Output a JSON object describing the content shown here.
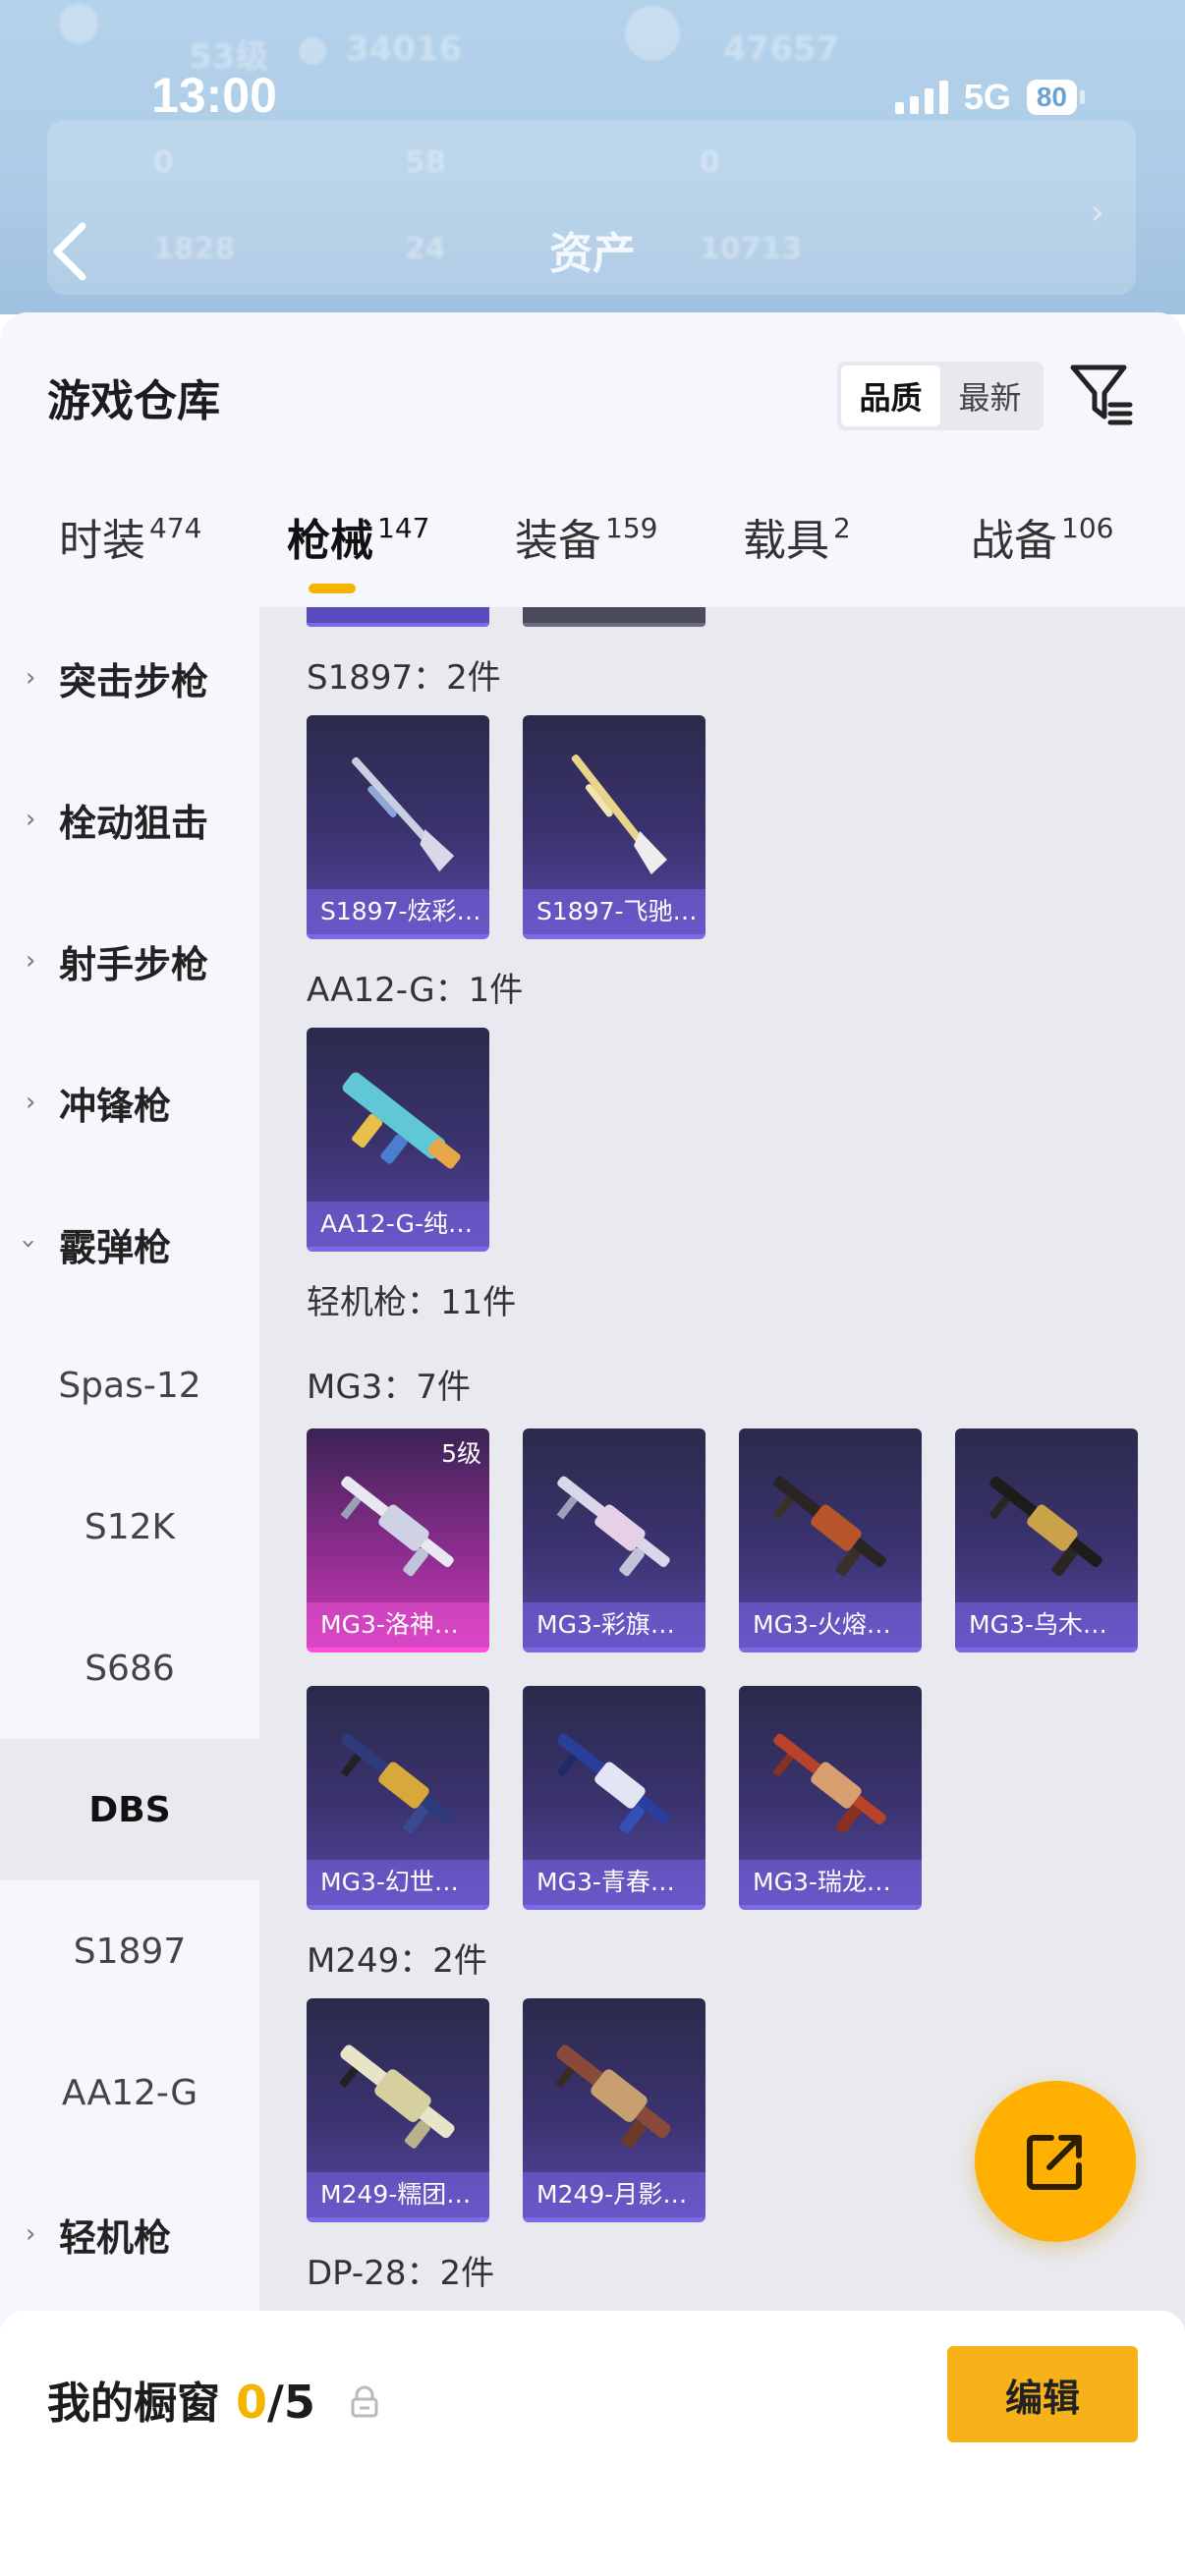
{
  "status_bar": {
    "time": "13:00",
    "network": "5G",
    "battery": "80"
  },
  "header": {
    "title": "资产"
  },
  "header_background_text": [
    "53级",
    "34016",
    "47657",
    "0",
    "58",
    "0",
    "1828",
    "24",
    "10713"
  ],
  "warehouse": {
    "title": "游戏仓库",
    "sort_options": [
      "品质",
      "最新"
    ],
    "active_sort": "品质"
  },
  "tabs": [
    {
      "label": "时装",
      "count": "474"
    },
    {
      "label": "枪械",
      "count": "147",
      "active": true
    },
    {
      "label": "装备",
      "count": "159"
    },
    {
      "label": "载具",
      "count": "2"
    },
    {
      "label": "战备",
      "count": "106"
    }
  ],
  "sidebar": {
    "items": [
      {
        "label": "突击步枪",
        "type": "category",
        "expanded": false
      },
      {
        "label": "栓动狙击",
        "type": "category",
        "expanded": false
      },
      {
        "label": "射手步枪",
        "type": "category",
        "expanded": false
      },
      {
        "label": "冲锋枪",
        "type": "category",
        "expanded": false
      },
      {
        "label": "霰弹枪",
        "type": "category",
        "expanded": true
      },
      {
        "label": "Spas-12",
        "type": "sub"
      },
      {
        "label": "S12K",
        "type": "sub"
      },
      {
        "label": "S686",
        "type": "sub"
      },
      {
        "label": "DBS",
        "type": "sub",
        "active": true
      },
      {
        "label": "S1897",
        "type": "sub"
      },
      {
        "label": "AA12-G",
        "type": "sub"
      },
      {
        "label": "轻机枪",
        "type": "category",
        "expanded": false
      }
    ]
  },
  "groups": [
    {
      "label": "S1897：2件",
      "items": [
        {
          "name": "S1897-炫彩…"
        },
        {
          "name": "S1897-飞驰…"
        }
      ]
    },
    {
      "label": "AA12-G：1件",
      "items": [
        {
          "name": "AA12-G-纯…"
        }
      ]
    },
    {
      "label": "轻机枪：11件",
      "items": []
    },
    {
      "label": "MG3：7件",
      "items": [
        {
          "name": "MG3-洛神…",
          "level": "5级",
          "rarity": "pink"
        },
        {
          "name": "MG3-彩旗…"
        },
        {
          "name": "MG3-火熔…"
        },
        {
          "name": "MG3-乌木…"
        },
        {
          "name": "MG3-幻世…"
        },
        {
          "name": "MG3-青春…"
        },
        {
          "name": "MG3-瑞龙…"
        }
      ]
    },
    {
      "label": "M249：2件",
      "items": [
        {
          "name": "M249-糯团…"
        },
        {
          "name": "M249-月影…"
        }
      ]
    },
    {
      "label": "DP-28：2件",
      "items": []
    }
  ],
  "showcase": {
    "title": "我的橱窗",
    "current": "0",
    "total": "/5",
    "edit_label": "编辑"
  },
  "colors": {
    "accent": "#f5b400",
    "card_purple": "#3b3370",
    "card_pink": "#cc3bb7",
    "content_bg": "#e9eaef"
  },
  "icons": [
    "back-arrow-icon",
    "filter-icon",
    "share-icon",
    "lock-icon",
    "chevron-right-icon",
    "chevron-down-icon"
  ]
}
